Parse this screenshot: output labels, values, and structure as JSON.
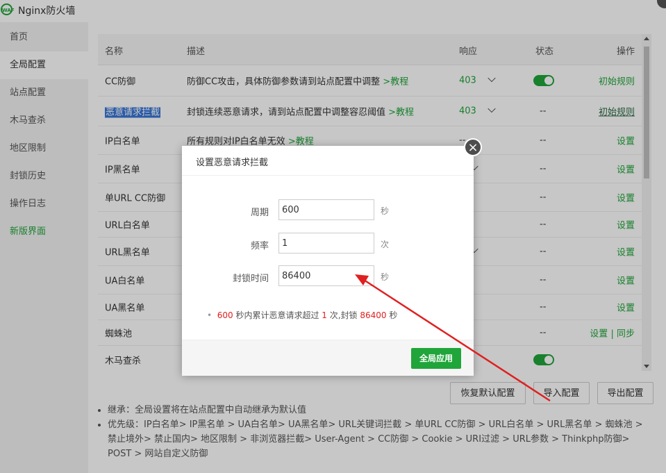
{
  "app": {
    "title": "Nginx防火墙",
    "logo_text": "WAF"
  },
  "sidebar": {
    "items": [
      {
        "label": "首页"
      },
      {
        "label": "全局配置"
      },
      {
        "label": "站点配置"
      },
      {
        "label": "木马查杀"
      },
      {
        "label": "地区限制"
      },
      {
        "label": "封锁历史"
      },
      {
        "label": "操作日志"
      },
      {
        "label": "新版界面"
      }
    ]
  },
  "table": {
    "headers": {
      "name": "名称",
      "desc": "描述",
      "response": "响应",
      "status": "状态",
      "action": "操作"
    },
    "rows": [
      {
        "name": "CC防御",
        "desc": "防御CC攻击，具体防御参数请到站点配置中调整",
        "link": ">教程",
        "response": "403",
        "status": "",
        "action": "初始规则"
      },
      {
        "name": "恶意请求拦截",
        "desc": "封锁连续恶意请求，请到站点配置中调整容忍阈值",
        "link": ">教程",
        "response": "403",
        "status": "--",
        "action": "初始规则"
      },
      {
        "name": "IP白名单",
        "desc": "所有规则对IP白名单无效",
        "link": ">教程",
        "response": "--",
        "status": "--",
        "action": "设置"
      },
      {
        "name": "IP黑名单",
        "desc": "",
        "link": "",
        "response": "",
        "status": "--",
        "action": "设置"
      },
      {
        "name": "单URL CC防御",
        "desc": "",
        "link": "",
        "response": "",
        "status": "--",
        "action": "设置"
      },
      {
        "name": "URL白名单",
        "desc": "",
        "link": "",
        "response": "",
        "status": "--",
        "action": "设置"
      },
      {
        "name": "URL黑名单",
        "desc": "",
        "link": "",
        "response": "",
        "status": "--",
        "action": "设置"
      },
      {
        "name": "UA白名单",
        "desc": "",
        "link": "",
        "response": "",
        "status": "--",
        "action": "设置"
      },
      {
        "name": "UA黑名单",
        "desc": "",
        "link": "",
        "response": "",
        "status": "--",
        "action": "设置"
      },
      {
        "name": "蜘蛛池",
        "desc": "",
        "link": "",
        "response": "",
        "status": "--",
        "action": "设置",
        "action2": "同步",
        "sep": "|"
      },
      {
        "name": "木马查杀",
        "desc": "",
        "link": "",
        "response": "",
        "status": "",
        "action": ""
      }
    ]
  },
  "buttons": {
    "restore": "恢复默认配置",
    "import": "导入配置",
    "export": "导出配置"
  },
  "notes": [
    "继承：全局设置将在站点配置中自动继承为默认值",
    "优先级：IP白名单> IP黑名单 > UA白名单> UA黑名单> URL关键词拦截 > 单URL CC防御 > URL白名单 > URL黑名单 > 蜘蛛池 > 禁止境外> 禁止国内> 地区限制 > 非浏览器拦截> User-Agent > CC防御 > Cookie > URI过滤 > URL参数 > Thinkphp防御> POST > 网站自定义防御"
  ],
  "dialog": {
    "title": "设置恶意请求拦截",
    "fields": [
      {
        "label": "周期",
        "value": "600",
        "unit": "秒"
      },
      {
        "label": "频率",
        "value": "1",
        "unit": "次"
      },
      {
        "label": "封锁时间",
        "value": "86400",
        "unit": "秒"
      }
    ],
    "tip": {
      "v1": "600",
      "t1": " 秒内累计恶意请求超过 ",
      "v2": "1",
      "t2": " 次,封锁 ",
      "v3": "86400",
      "t3": " 秒"
    },
    "apply_label": "全局应用",
    "close_glyph": "×"
  },
  "colors": {
    "accent": "#20a53a",
    "highlight": "#e02020",
    "arrow": "#e02020"
  }
}
